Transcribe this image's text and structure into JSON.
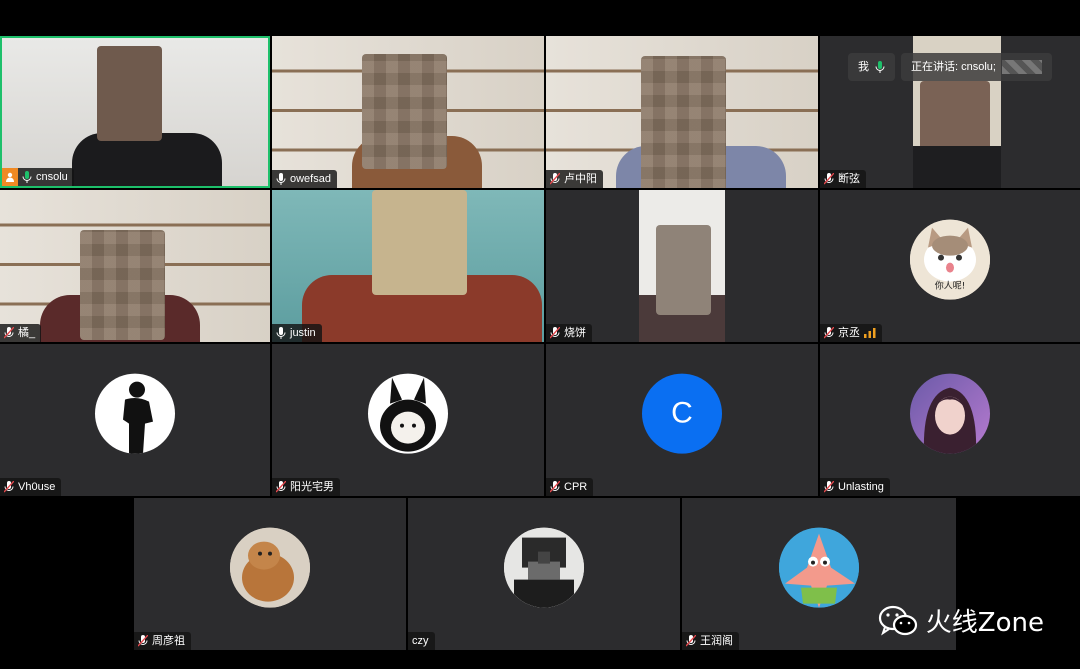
{
  "speaker": {
    "me_label": "我",
    "speaking_prefix": "正在讲话: cnsolu;"
  },
  "tiles": [
    {
      "name": "cnsolu"
    },
    {
      "name": "owefsad"
    },
    {
      "name": "卢中阳"
    },
    {
      "name": "断弦"
    },
    {
      "name": "橘_"
    },
    {
      "name": "justin"
    },
    {
      "name": "烧饼"
    },
    {
      "name": "京丞"
    },
    {
      "name": "Vh0use"
    },
    {
      "name": "阳光宅男"
    },
    {
      "name": "CPR",
      "avatar_letter": "C"
    },
    {
      "name": "Unlasting"
    },
    {
      "name": "周彦祖"
    },
    {
      "name": "czy"
    },
    {
      "name": "王润阁"
    }
  ],
  "avatar_captions": {
    "cat": "你人呢!"
  },
  "watermark": "火线Zone",
  "colors": {
    "active_border": "#1ec06b",
    "tile_bg": "#2c2c2e",
    "cpr_avatar": "#0a6ff2",
    "muted_mic": "#e5484d"
  }
}
